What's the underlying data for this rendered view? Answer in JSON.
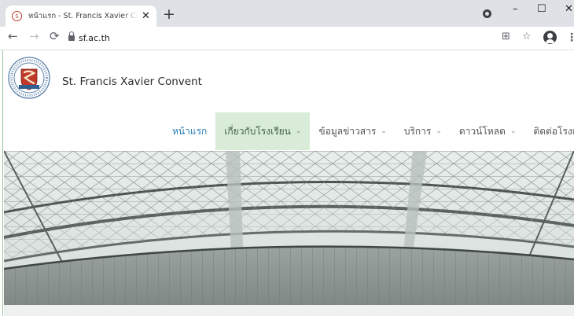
{
  "browser": {
    "tab_title": "หน้าแรก - St. Francis Xavier Convent",
    "favicon_glyph": "S",
    "new_tab": "+",
    "close": "✕",
    "url": "sf.ac.th",
    "window": {
      "minimize": "–",
      "maximize": "☐",
      "close": "✕"
    },
    "icons": {
      "back": "←",
      "forward": "→",
      "reload": "⟳",
      "translate": "⊞",
      "star": "☆",
      "menu": "⋮"
    }
  },
  "site": {
    "name": "St. Francis Xavier Convent",
    "menu": [
      {
        "label": "หน้าแรก",
        "dropdown": false
      },
      {
        "label": "เกี่ยวกับโรงเรียน",
        "dropdown": true
      },
      {
        "label": "ข้อมูลข่าวสาร",
        "dropdown": true
      },
      {
        "label": "บริการ",
        "dropdown": true
      },
      {
        "label": "ดาวน์โหลด",
        "dropdown": true
      },
      {
        "label": "ติดต่อโรงเรียน",
        "dropdown": false
      }
    ],
    "chevron": "⌄"
  },
  "colors": {
    "accent_link": "#2a7fb8",
    "active_menu_bg": "#d8ecd7",
    "logo_red": "#c0392b"
  }
}
